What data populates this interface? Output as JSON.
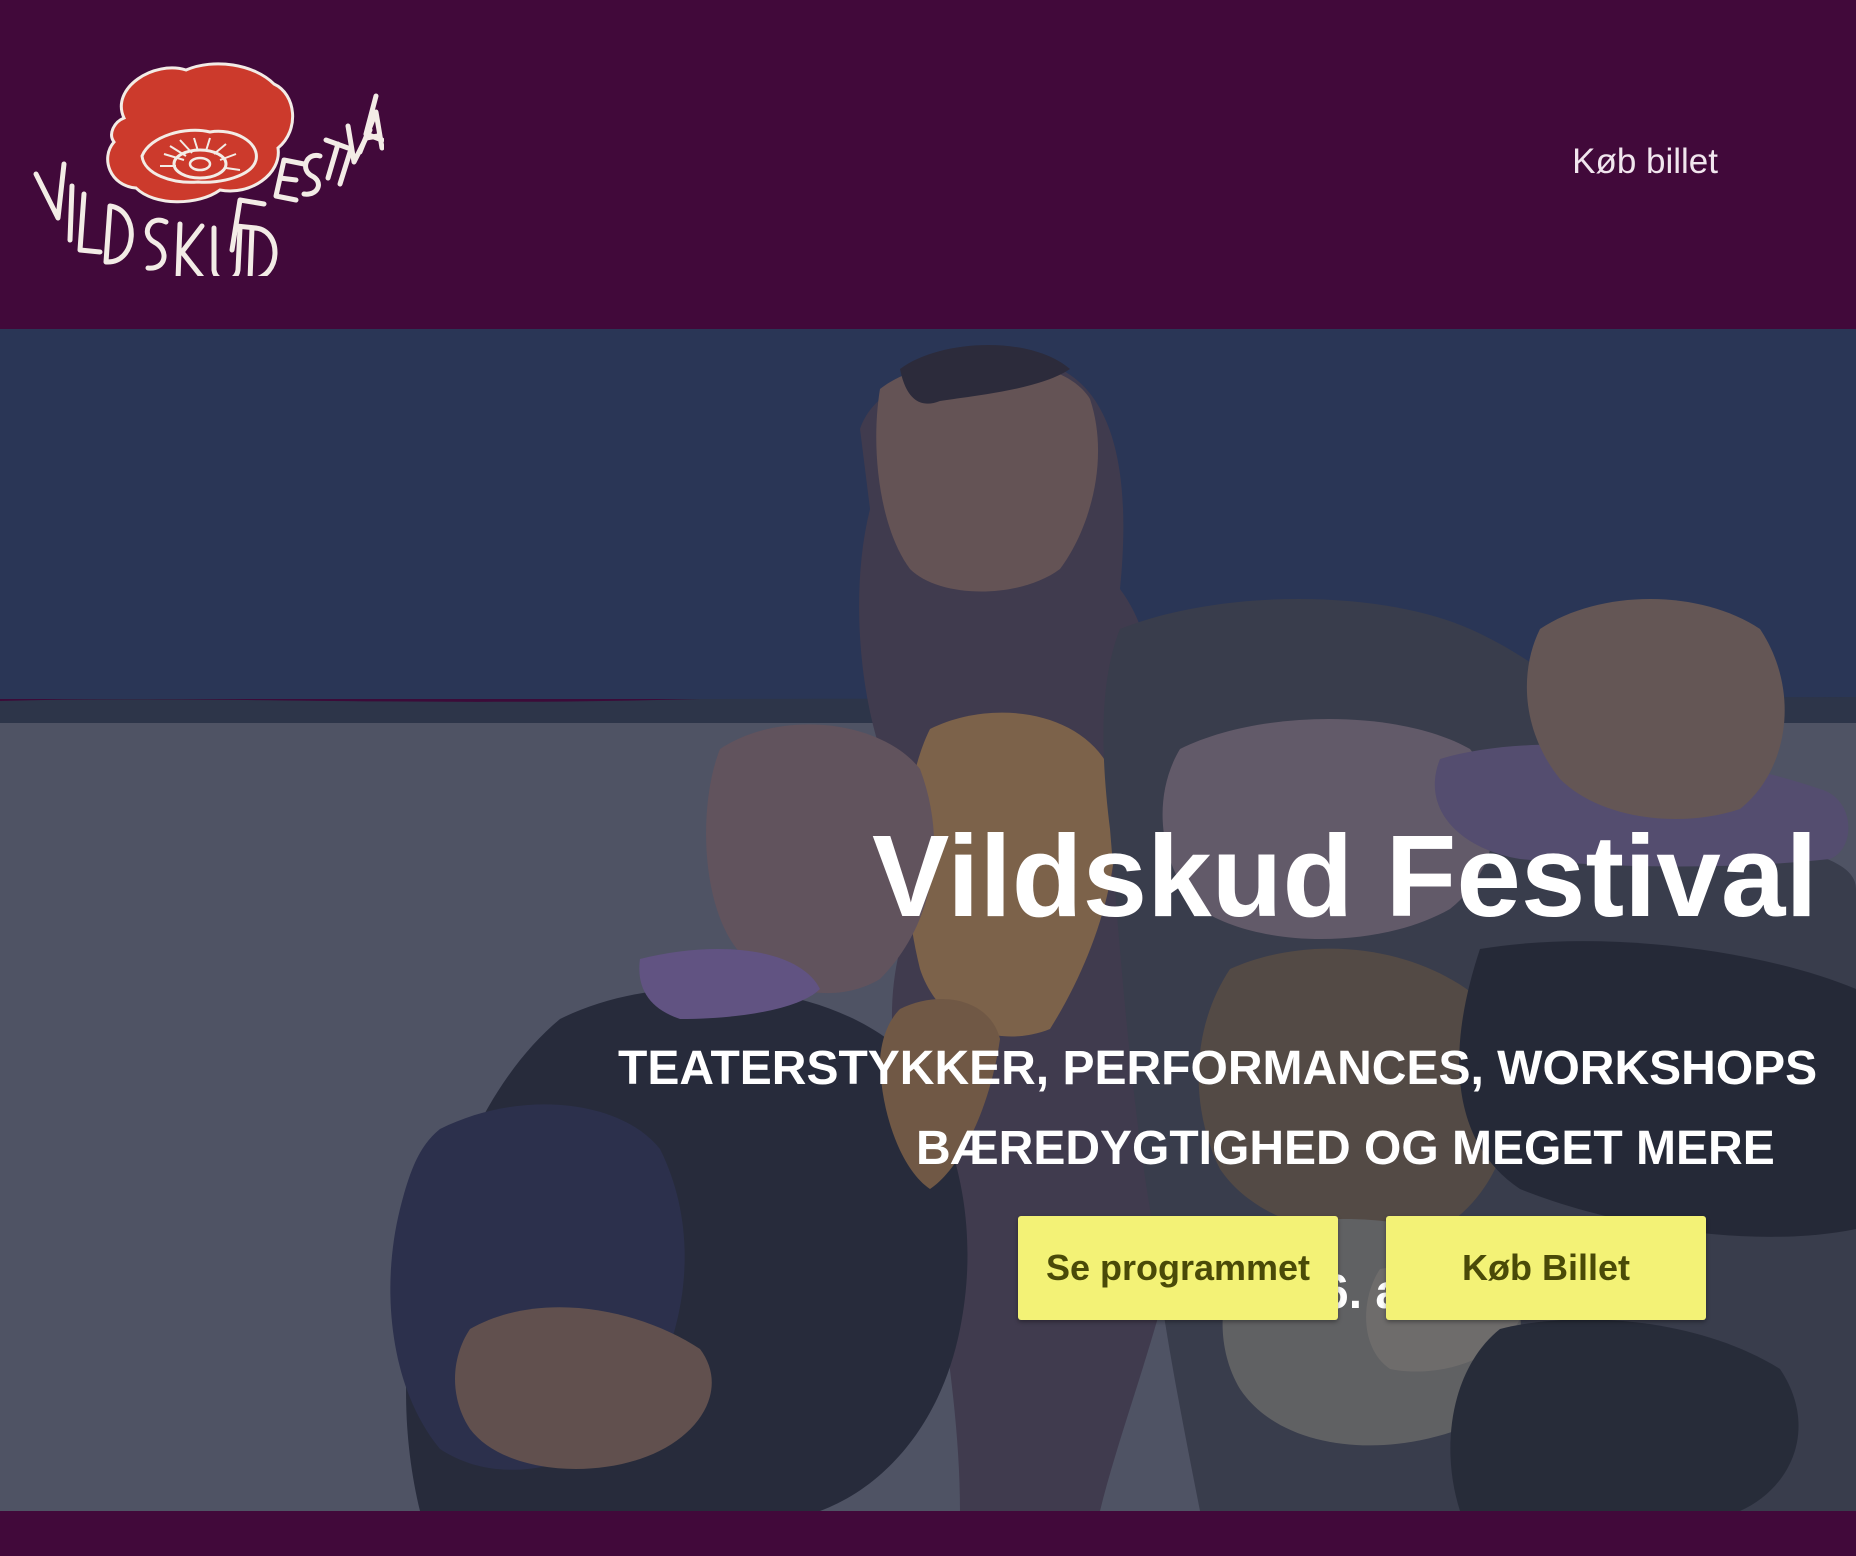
{
  "header": {
    "logo": {
      "text": "VILDSKUD FESTIVAL",
      "icon": "poppy-flower-icon",
      "flower_color": "#cc3a2c"
    },
    "nav": {
      "buy_ticket": "Køb billet"
    }
  },
  "hero": {
    "title": "Vildskud Festival",
    "subtitle_line1": "TEATERSTYKKER, PERFORMANCES, WORKSHOPS",
    "subtitle_line2": "BÆREDYGTIGHED OG MEGET MERE",
    "date": "D. 2. - 6. august",
    "buttons": {
      "program": "Se programmet",
      "ticket": "Køb Billet"
    }
  },
  "colors": {
    "header_bg": "#41093a",
    "sky": "#2d3a5c",
    "ground": "#575a6c",
    "button_bg": "#f3f276",
    "button_text": "#4a4a08",
    "text": "#ffffff"
  }
}
